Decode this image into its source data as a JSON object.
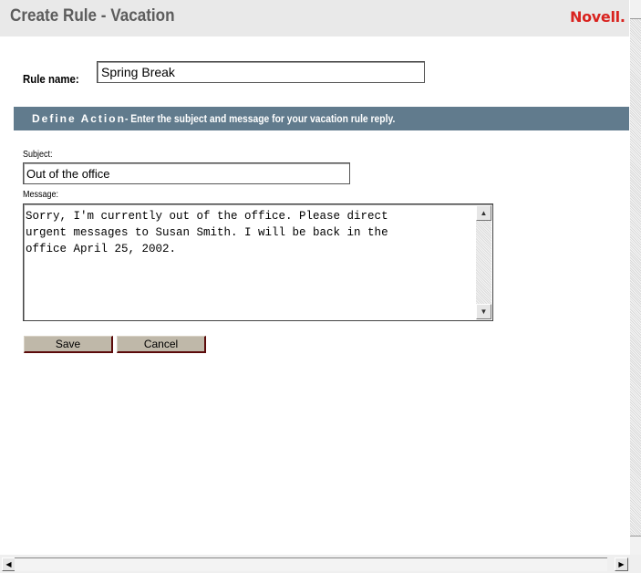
{
  "header": {
    "title": "Create Rule - Vacation",
    "brand": "Novell."
  },
  "rule": {
    "label": "Rule name:",
    "value": "Spring Break"
  },
  "section": {
    "heading": "Define Action",
    "description": "- Enter the subject and message for your vacation rule reply."
  },
  "subject": {
    "label": "Subject:",
    "value": "Out of the office"
  },
  "message": {
    "label": "Message:",
    "value": "Sorry, I'm currently out of the office. Please direct\nurgent messages to Susan Smith. I will be back in the\noffice April 25, 2002."
  },
  "buttons": {
    "save": "Save",
    "cancel": "Cancel"
  },
  "colors": {
    "section_bar": "#617b8d",
    "brand": "#d9231f",
    "button_face": "#bfb8a9",
    "button_shadow": "#5b0a0a"
  }
}
